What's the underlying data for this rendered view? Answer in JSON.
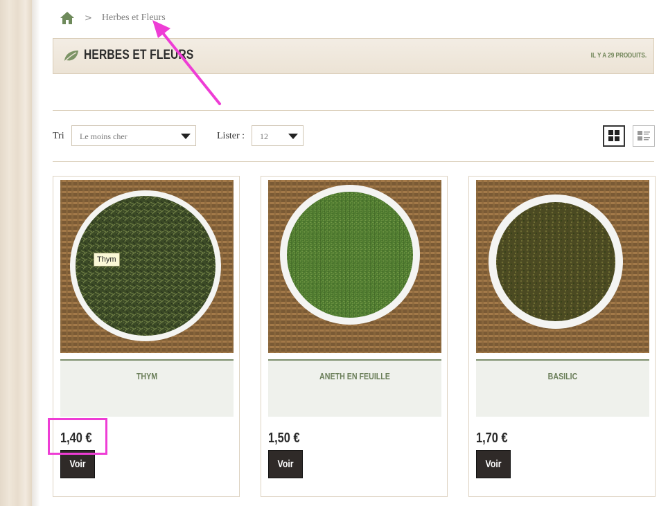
{
  "breadcrumb": {
    "home_icon": "home-icon",
    "separator": ">",
    "current": "Herbes et Fleurs"
  },
  "category": {
    "icon": "leaf-icon",
    "title": "HERBES ET FLEURS",
    "count_text": "IL Y A 29 PRODUITS."
  },
  "toolbar": {
    "sort_label": "Tri",
    "sort_value": "Le moins cher",
    "list_label": "Lister :",
    "list_value": "12",
    "view_grid_icon": "grid-view-icon",
    "view_list_icon": "list-view-icon"
  },
  "products": [
    {
      "name": "THYM",
      "price": "1,40 €",
      "button": "Voir",
      "tooltip": "Thym"
    },
    {
      "name": "ANETH EN FEUILLE",
      "price": "1,50 €",
      "button": "Voir"
    },
    {
      "name": "BASILIC",
      "price": "1,70 €",
      "button": "Voir"
    }
  ],
  "colors": {
    "accent_green": "#6b7f5a",
    "button_dark": "#2f2a28",
    "annotation_magenta": "#ee3dd5"
  }
}
